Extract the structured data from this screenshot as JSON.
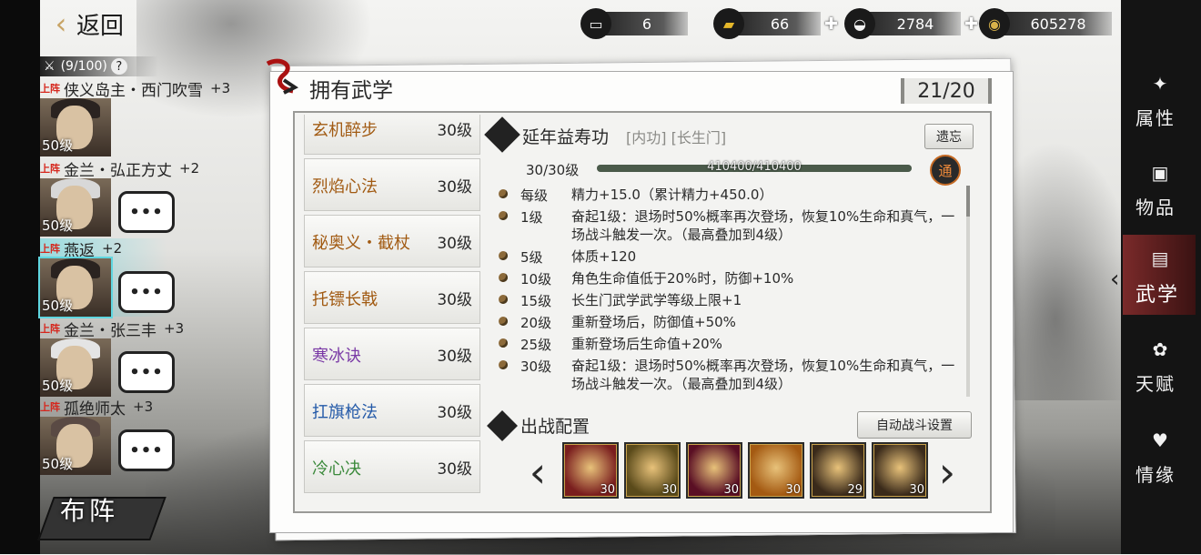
{
  "header": {
    "back_label": "返回",
    "resources": [
      {
        "icon": "table-icon",
        "value": "6",
        "has_plus": false
      },
      {
        "icon": "gold-bar-icon",
        "value": "66",
        "has_plus": true
      },
      {
        "icon": "silver-ingot-icon",
        "value": "2784",
        "has_plus": true
      },
      {
        "icon": "coin-icon",
        "value": "605278",
        "has_plus": false
      }
    ]
  },
  "roster": {
    "capacity": "(9/100)",
    "help": "?",
    "heroes": [
      {
        "tag": "上阵",
        "name": "侠义岛主・西门吹雪",
        "plus": "+3",
        "level": "50级",
        "chat": "",
        "selected": false
      },
      {
        "tag": "上阵",
        "name": "金兰・弘正方丈",
        "plus": "+2",
        "level": "50级",
        "chat": "•••",
        "selected": false
      },
      {
        "tag": "上阵",
        "name": "燕返",
        "plus": "+2",
        "level": "50级",
        "chat": "•••",
        "selected": true
      },
      {
        "tag": "上阵",
        "name": "金兰・张三丰",
        "plus": "+3",
        "level": "50级",
        "chat": "•••",
        "selected": false
      },
      {
        "tag": "上阵",
        "name": "孤绝师太",
        "plus": "+3",
        "level": "50级",
        "chat": "•••",
        "selected": false
      }
    ],
    "formation_label": "布阵"
  },
  "panel": {
    "title": "拥有武学",
    "count": "21/20",
    "martial_arts": [
      {
        "name": "玄机醉步",
        "level": "30级",
        "color": "orange"
      },
      {
        "name": "烈焰心法",
        "level": "30级",
        "color": "orange"
      },
      {
        "name": "秘奥义・截杖",
        "level": "30级",
        "color": "orange"
      },
      {
        "name": "托镖长戟",
        "level": "30级",
        "color": "orange"
      },
      {
        "name": "寒冰诀",
        "level": "30级",
        "color": "purple"
      },
      {
        "name": "扛旗枪法",
        "level": "30级",
        "color": "blue"
      },
      {
        "name": "冷心决",
        "level": "30级",
        "color": "green"
      }
    ],
    "detail": {
      "name": "延年益寿功",
      "tags": "[内功] [长生门]",
      "forget_label": "遗忘",
      "level_label": "30/30级",
      "exp_text": "410400/410400",
      "exp_fraction": 1.0,
      "badge": "通",
      "bonuses": [
        {
          "level": "每级",
          "desc": "精力+15.0（累计精力+450.0）"
        },
        {
          "level": "1级",
          "desc": "奋起1级：退场时50%概率再次登场，恢复10%生命和真气，一场战斗触发一次。（最高叠加到4级）"
        },
        {
          "level": "5级",
          "desc": "体质+120"
        },
        {
          "level": "10级",
          "desc": "角色生命值低于20%时，防御+10%"
        },
        {
          "level": "15级",
          "desc": "长生门武学武学等级上限+1"
        },
        {
          "level": "20级",
          "desc": "重新登场后，防御值+50%"
        },
        {
          "level": "25级",
          "desc": "重新登场后生命值+20%"
        },
        {
          "level": "30级",
          "desc": "奋起1级：退场时50%概率再次登场，恢复10%生命和真气，一场战斗触发一次。（最高叠加到4级）"
        }
      ]
    },
    "battle": {
      "title": "出战配置",
      "auto_label": "自动战斗设置",
      "prev": "‹",
      "next": "›",
      "skills": [
        {
          "icon": "blade-slash-skill-icon",
          "level": "30",
          "bg": "#7a1e1e"
        },
        {
          "icon": "golden-claw-skill-icon",
          "level": "30",
          "bg": "#5a4a1a"
        },
        {
          "icon": "crimson-orb-skill-icon",
          "level": "30",
          "bg": "#5a0f24"
        },
        {
          "icon": "flying-kick-skill-icon",
          "level": "30",
          "bg": "#a45a12"
        },
        {
          "icon": "meditation-skill-icon",
          "level": "29",
          "bg": "#3a2a1a"
        },
        {
          "icon": "meditation-skill-icon",
          "level": "30",
          "bg": "#3a2a1a"
        }
      ]
    }
  },
  "tabs": [
    {
      "label": "属性",
      "icon": "bird-icon",
      "active": false
    },
    {
      "label": "物品",
      "icon": "gift-box-icon",
      "active": false
    },
    {
      "label": "武学",
      "icon": "scroll-book-icon",
      "active": true
    },
    {
      "label": "天赋",
      "icon": "branch-icon",
      "active": false
    },
    {
      "label": "情缘",
      "icon": "heart-knot-icon",
      "active": false
    }
  ],
  "colors": {
    "orange": "#a15a12",
    "purple": "#7a3aa6",
    "blue": "#245aa8",
    "green": "#3c8a3c",
    "selected_glow": "#5fd6e0",
    "active_tab": "#7a2a2a"
  }
}
